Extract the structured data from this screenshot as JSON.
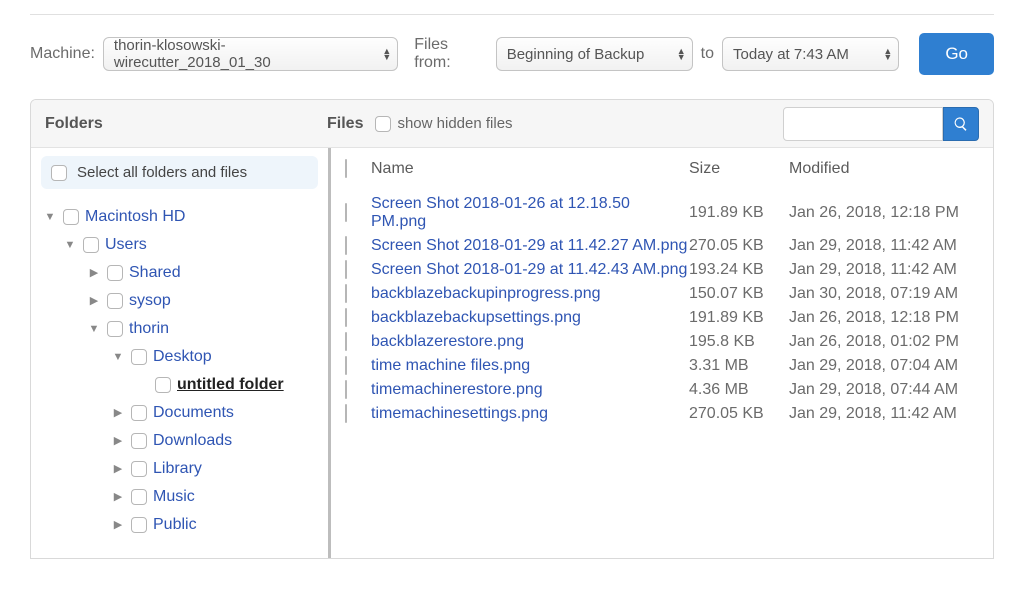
{
  "labels": {
    "machine": "Machine:",
    "filesFrom": "Files from:",
    "to": "to",
    "go": "Go",
    "foldersTitle": "Folders",
    "filesTitle": "Files",
    "showHidden": "show hidden files",
    "selectAll": "Select all folders and files",
    "colName": "Name",
    "colSize": "Size",
    "colModified": "Modified"
  },
  "selects": {
    "machine": "thorin-klosowski-wirecutter_2018_01_30",
    "from": "Beginning of Backup",
    "to": "Today at 7:43 AM"
  },
  "tree": [
    {
      "indent": 0,
      "arrow": "down",
      "label": "Macintosh HD",
      "bold": false
    },
    {
      "indent": 1,
      "arrow": "down",
      "label": "Users",
      "bold": false
    },
    {
      "indent": 2,
      "arrow": "right",
      "label": "Shared",
      "bold": false
    },
    {
      "indent": 2,
      "arrow": "right",
      "label": "sysop",
      "bold": false
    },
    {
      "indent": 2,
      "arrow": "down",
      "label": "thorin",
      "bold": false
    },
    {
      "indent": 3,
      "arrow": "down",
      "label": "Desktop",
      "bold": false
    },
    {
      "indent": 4,
      "arrow": "none",
      "label": "untitled folder",
      "bold": true
    },
    {
      "indent": 3,
      "arrow": "right",
      "label": "Documents",
      "bold": false
    },
    {
      "indent": 3,
      "arrow": "right",
      "label": "Downloads",
      "bold": false
    },
    {
      "indent": 3,
      "arrow": "right",
      "label": "Library",
      "bold": false
    },
    {
      "indent": 3,
      "arrow": "right",
      "label": "Music",
      "bold": false
    },
    {
      "indent": 3,
      "arrow": "right",
      "label": "Public",
      "bold": false
    }
  ],
  "files": [
    {
      "name": "Screen Shot 2018-01-26 at 12.18.50 PM.png",
      "size": "191.89 KB",
      "mod": "Jan 26, 2018, 12:18 PM"
    },
    {
      "name": "Screen Shot 2018-01-29 at 11.42.27 AM.png",
      "size": "270.05 KB",
      "mod": "Jan 29, 2018, 11:42 AM"
    },
    {
      "name": "Screen Shot 2018-01-29 at 11.42.43 AM.png",
      "size": "193.24 KB",
      "mod": "Jan 29, 2018, 11:42 AM"
    },
    {
      "name": "backblazebackupinprogress.png",
      "size": "150.07 KB",
      "mod": "Jan 30, 2018, 07:19 AM"
    },
    {
      "name": "backblazebackupsettings.png",
      "size": "191.89 KB",
      "mod": "Jan 26, 2018, 12:18 PM"
    },
    {
      "name": "backblazerestore.png",
      "size": "195.8 KB",
      "mod": "Jan 26, 2018, 01:02 PM"
    },
    {
      "name": "time machine files.png",
      "size": "3.31 MB",
      "mod": "Jan 29, 2018, 07:04 AM"
    },
    {
      "name": "timemachinerestore.png",
      "size": "4.36 MB",
      "mod": "Jan 29, 2018, 07:44 AM"
    },
    {
      "name": "timemachinesettings.png",
      "size": "270.05 KB",
      "mod": "Jan 29, 2018, 11:42 AM"
    }
  ]
}
